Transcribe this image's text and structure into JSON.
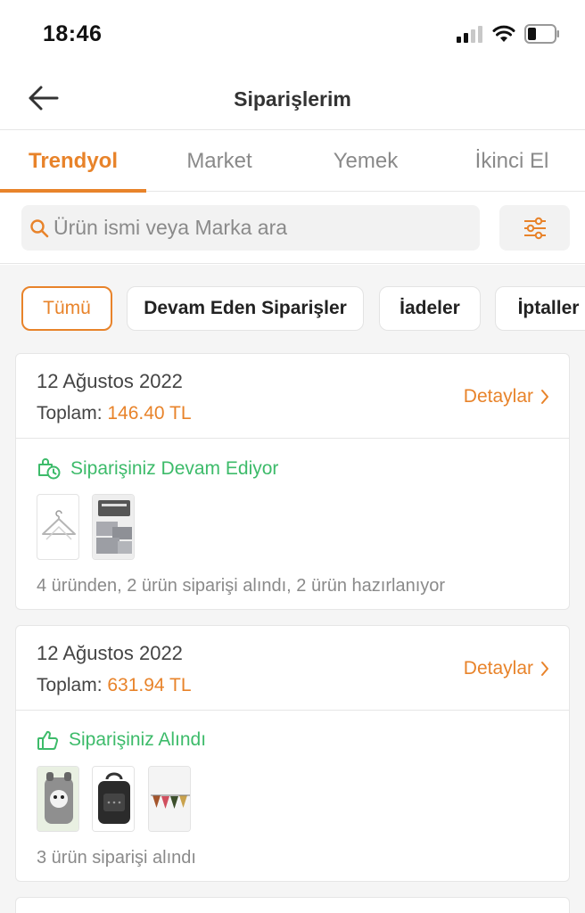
{
  "status_bar": {
    "time": "18:46"
  },
  "nav": {
    "title": "Siparişlerim"
  },
  "tabs": [
    {
      "label": "Trendyol",
      "active": true
    },
    {
      "label": "Market",
      "active": false
    },
    {
      "label": "Yemek",
      "active": false
    },
    {
      "label": "İkinci El",
      "active": false
    }
  ],
  "search": {
    "placeholder": "Ürün ismi veya Marka ara",
    "value": ""
  },
  "filters": [
    {
      "label": "Tümü",
      "active": true
    },
    {
      "label": "Devam Eden Siparişler",
      "active": false
    },
    {
      "label": "İadeler",
      "active": false
    },
    {
      "label": "İptaller",
      "active": false
    }
  ],
  "orders": [
    {
      "date": "12 Ağustos 2022",
      "total_label": "Toplam:",
      "total_amount": "146.40 TL",
      "details_label": "Detaylar",
      "status": "Siparişiniz Devam Ediyor",
      "status_icon": "package-clock-icon",
      "thumbnails": [
        "hanger-product",
        "storage-box-product"
      ],
      "summary": "4 üründen, 2 ürün siparişi alındı, 2 ürün hazırlanıyor"
    },
    {
      "date": "12 Ağustos 2022",
      "total_label": "Toplam:",
      "total_amount": "631.94 TL",
      "details_label": "Detaylar",
      "status": "Siparişiniz Alındı",
      "status_icon": "thumbs-up-icon",
      "thumbnails": [
        "kids-backpack-product",
        "black-backpack-product",
        "banner-product"
      ],
      "summary": "3 ürün siparişi alındı"
    }
  ],
  "colors": {
    "accent": "#e8832a",
    "success": "#3dbb6a",
    "muted": "#8a8a8a",
    "background": "#f5f5f5"
  }
}
